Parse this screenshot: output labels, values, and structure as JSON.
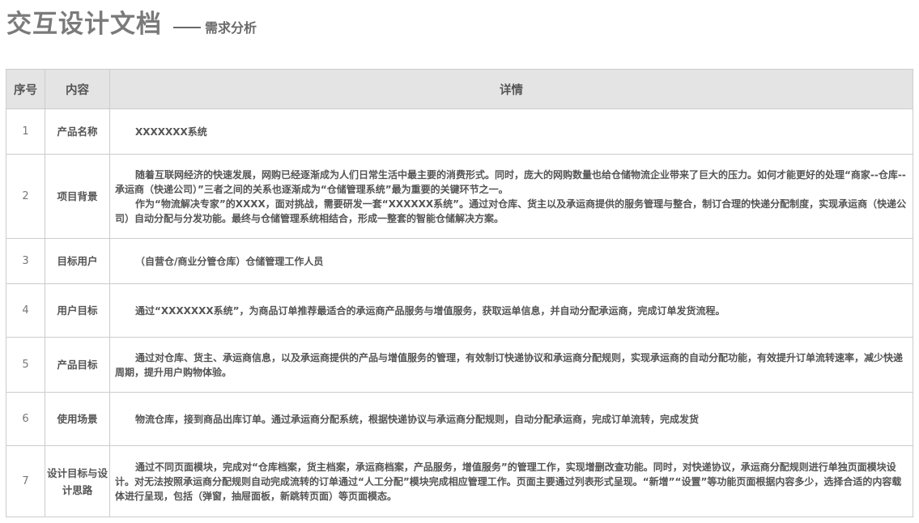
{
  "header": {
    "title": "交互设计文档",
    "subtitle": "需求分析"
  },
  "table": {
    "columns": [
      "序号",
      "内容",
      "详情"
    ],
    "rows": [
      {
        "num": "1",
        "label": "产品名称",
        "paragraphs": [
          "XXXXXXX系统"
        ]
      },
      {
        "num": "2",
        "label": "项目背景",
        "paragraphs": [
          "随着互联网经济的快速发展，网购已经逐渐成为人们日常生活中最主要的消费形式。同时，庞大的网购数量也给仓储物流企业带来了巨大的压力。如何才能更好的处理“商家--仓库--承运商（快递公司）”三者之间的关系也逐渐成为“仓储管理系统”最为重要的关键环节之一。",
          "作为“物流解决专家”的XXXX，面对挑战，需要研发一套“XXXXXX系统”。通过对仓库、货主以及承运商提供的服务管理与整合，制订合理的快递分配制度，实现承运商（快递公司）自动分配与分发功能。最终与仓储管理系统相结合，形成一整套的智能仓储解决方案。"
        ]
      },
      {
        "num": "3",
        "label": "目标用户",
        "paragraphs": [
          "（自营仓/商业分管仓库）仓储管理工作人员"
        ]
      },
      {
        "num": "4",
        "label": "用户目标",
        "paragraphs": [
          "通过“XXXXXXX系统”，为商品订单推荐最适合的承运商产品服务与增值服务，获取运单信息，并自动分配承运商，完成订单发货流程。"
        ]
      },
      {
        "num": "5",
        "label": "产品目标",
        "paragraphs": [
          "通过对仓库、货主、承运商信息，以及承运商提供的产品与增值服务的管理，有效制订快递协议和承运商分配规则，实现承运商的自动分配功能，有效提升订单流转速率，减少快递周期，提升用户购物体验。"
        ]
      },
      {
        "num": "6",
        "label": "使用场景",
        "paragraphs": [
          "物流仓库，接到商品出库订单。通过承运商分配系统，根据快递协议与承运商分配规则，自动分配承运商，完成订单流转，完成发货"
        ]
      },
      {
        "num": "7",
        "label": "设计目标与设计思路",
        "paragraphs": [
          "通过不同页面模块，完成对“仓库档案，货主档案，承运商档案，产品服务，增值服务”的管理工作，实现增删改查功能。同时，对快递协议，承运商分配规则进行单独页面模块设计。对无法按照承运商分配规则自动完成流转的订单通过“人工分配”模块完成相应管理工作。页面主要通过列表形式呈现。“新增”“设置”等功能页面根据内容多少，选择合适的内容载体进行呈现，包括（弹窗，抽屉面板，新跳转页面）等页面模态。"
        ]
      }
    ]
  }
}
